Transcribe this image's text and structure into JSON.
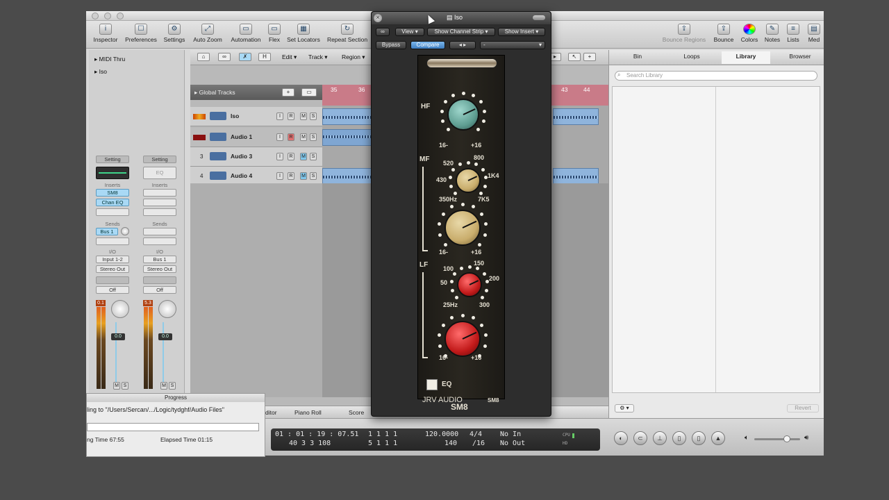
{
  "toolbar": {
    "items": [
      {
        "label": "Inspector",
        "icon": "info-icon"
      },
      {
        "label": "Preferences",
        "icon": "preferences-icon"
      },
      {
        "label": "Settings",
        "icon": "settings-icon"
      },
      {
        "label": "Auto Zoom",
        "icon": "zoom-icon"
      },
      {
        "label": "Automation",
        "icon": "automation-icon"
      },
      {
        "label": "Flex",
        "icon": "flex-icon"
      },
      {
        "label": "Set Locators",
        "icon": "locators-icon"
      },
      {
        "label": "Repeat Section",
        "icon": "repeat-icon"
      }
    ],
    "right_items": [
      {
        "label": "Bounce Regions",
        "icon": "bounce-regions-icon"
      },
      {
        "label": "Bounce",
        "icon": "bounce-icon"
      },
      {
        "label": "Colors",
        "icon": "colors-icon"
      },
      {
        "label": "Notes",
        "icon": "notes-icon"
      },
      {
        "label": "Lists",
        "icon": "lists-icon"
      },
      {
        "label": "Med",
        "icon": "media-icon"
      }
    ]
  },
  "inspector": {
    "midi_thru": "MIDI Thru",
    "iso": "Iso",
    "strip1": {
      "setting": "Setting",
      "inserts": "Inserts",
      "insert1": "SM8",
      "insert2": "Chan EQ",
      "sends": "Sends",
      "send1": "Bus 1",
      "io": "I/O",
      "input": "Input 1-2",
      "output": "Stereo Out",
      "auto": "Off",
      "peak": "0.1",
      "fader": "0.0",
      "m": "M",
      "s": "S"
    },
    "strip2": {
      "setting": "Setting",
      "eq": "EQ",
      "inserts": "Inserts",
      "sends": "Sends",
      "io": "I/O",
      "input": "Bus 1",
      "output": "Stereo Out",
      "auto": "Off",
      "peak": "5.3",
      "fader": "0.0",
      "m": "M",
      "s": "S"
    }
  },
  "arrange": {
    "menus": [
      "Edit",
      "Track",
      "Region"
    ],
    "tool_h": "H",
    "global_tracks": "Global Tracks",
    "ruler": [
      "35",
      "36",
      "43",
      "44"
    ],
    "tracks": [
      {
        "num": "",
        "name": "Iso"
      },
      {
        "num": "",
        "name": "Audio 1"
      },
      {
        "num": "3",
        "name": "Audio 3"
      },
      {
        "num": "4",
        "name": "Audio 4"
      }
    ],
    "track_buttons": {
      "i": "I",
      "r": "R",
      "m": "M",
      "s": "S"
    },
    "bottom_tabs": [
      "ditor",
      "Piano Roll",
      "Score"
    ]
  },
  "right_panel": {
    "tabs": [
      "Bin",
      "Loops",
      "Library",
      "Browser"
    ],
    "search_placeholder": "Search Library",
    "revert": "Revert"
  },
  "transport": {
    "time": "01 : 01 : 19 : 07.51",
    "bars": "40    3    3  108",
    "pos1": "1    1    1      1",
    "pos2": "5    1    1      1",
    "tempo": "120.0000",
    "tempo2": "140",
    "sig": "4/4",
    "div": "/16",
    "in": "No In",
    "out": "No Out",
    "cpu": "CPU",
    "hd": "HD"
  },
  "progress": {
    "title": "Progress",
    "message": "ling to \"/Users/Sercan/.../Logic/tydghf/Audio Files\"",
    "remaining": "ng Time 67:55",
    "elapsed": "Elapsed Time 01:15"
  },
  "plugin": {
    "title": "Iso",
    "view": "View",
    "show_channel_strip": "Show Channel Strip",
    "show_insert": "Show Insert",
    "bypass": "Bypass",
    "compare": "Compare",
    "preset": "-",
    "hf": "HF",
    "mf": "MF",
    "lf": "LF",
    "minus16": "16-",
    "plus16": "+16",
    "mf_freqs": {
      "f520": "520",
      "f800": "800",
      "f430": "430",
      "f1k4": "1K4",
      "f350": "350Hz",
      "f7k5": "7K5"
    },
    "lf_freqs": {
      "f100": "100",
      "f150": "150",
      "f50": "50",
      "f200": "200",
      "f25": "25Hz",
      "f300": "300"
    },
    "eq": "EQ",
    "brand": "JRV AUDIO",
    "model_small": "SM8",
    "model": "SM8"
  }
}
